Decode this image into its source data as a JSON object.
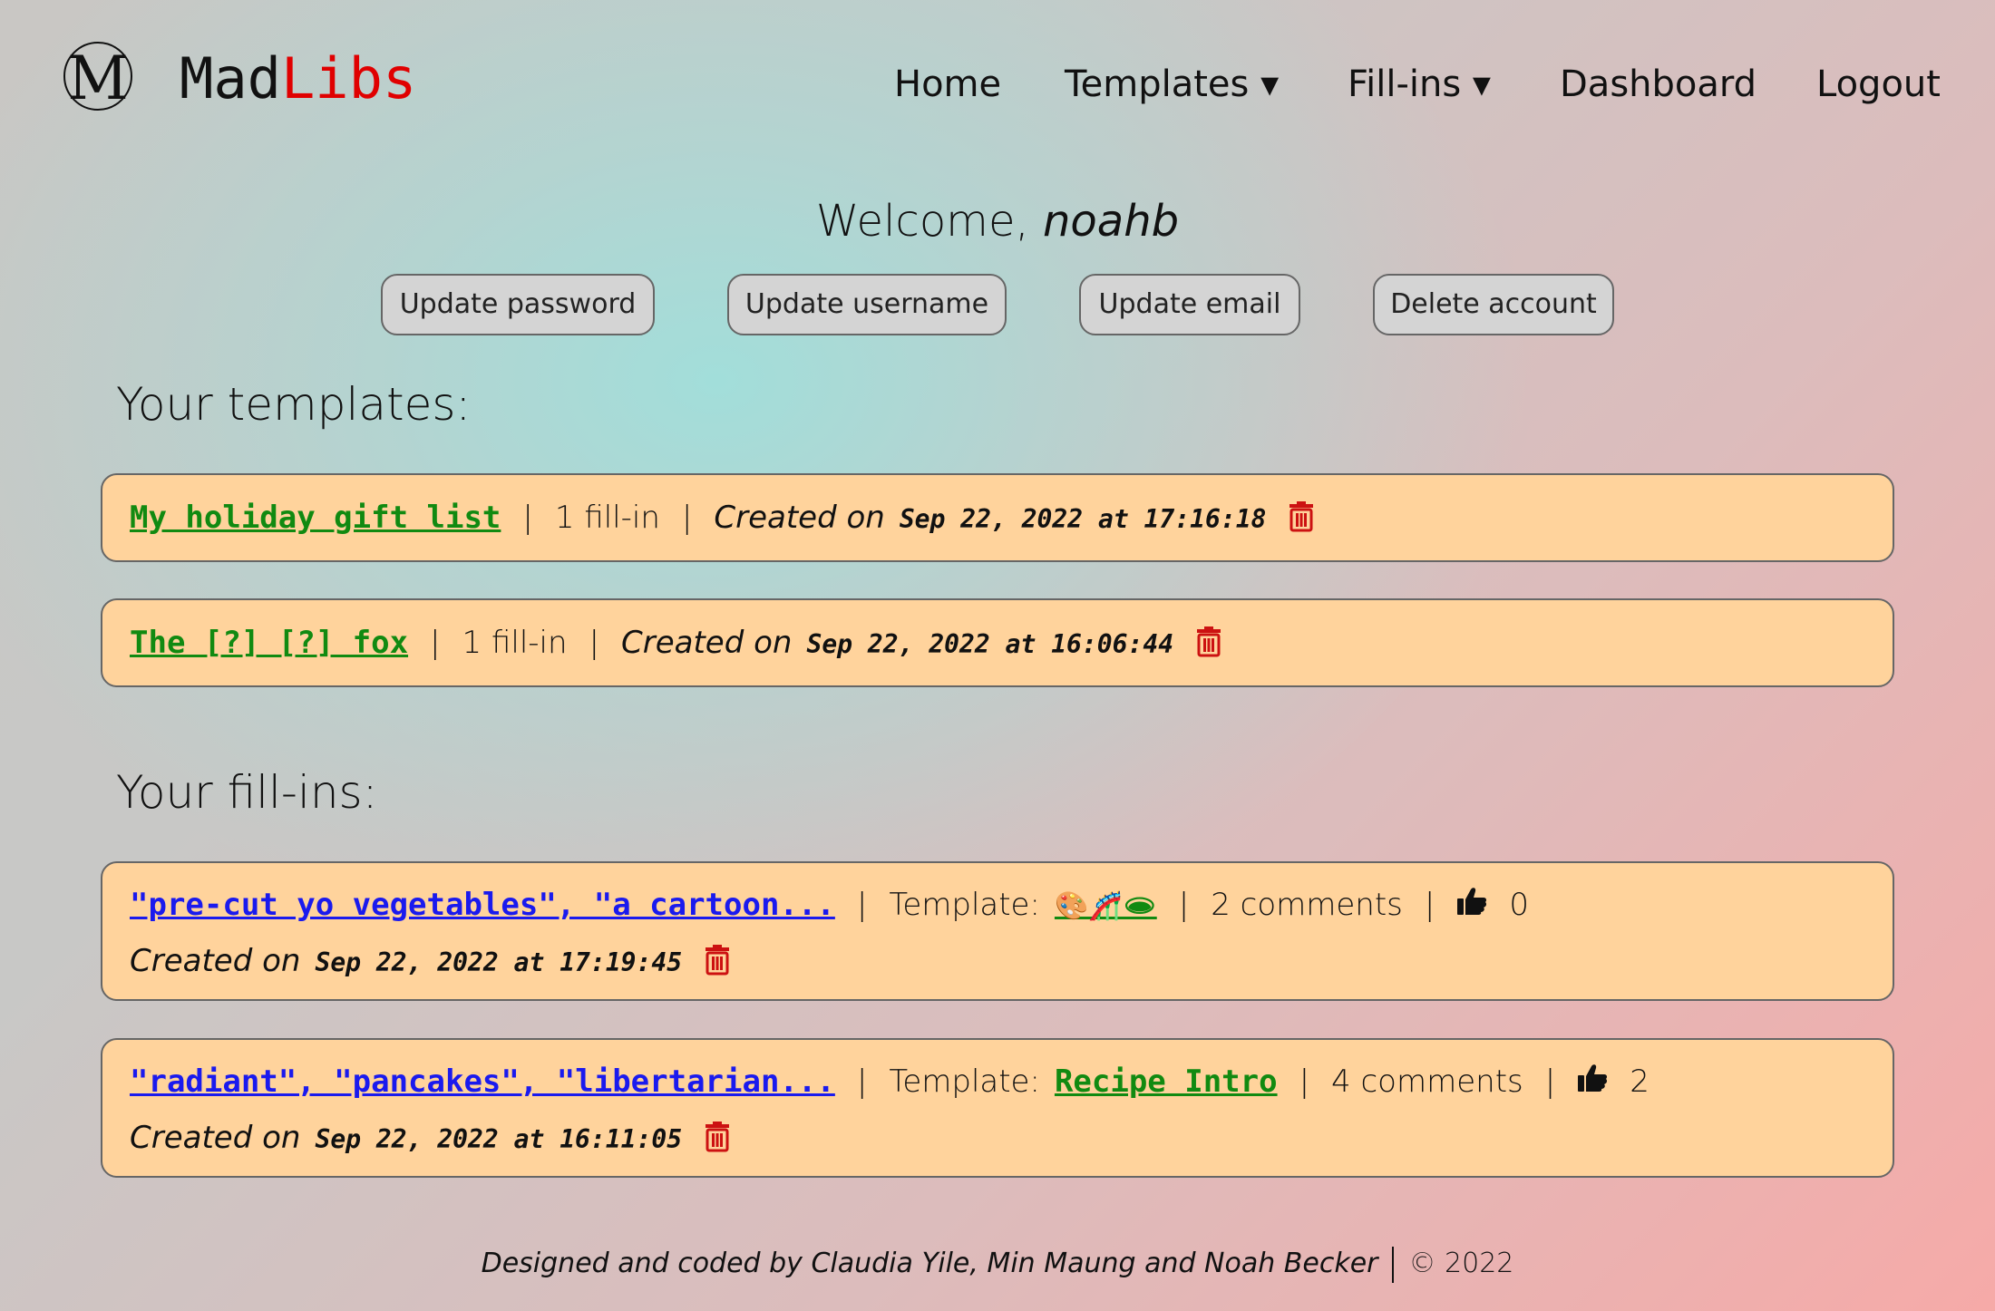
{
  "header": {
    "logo_letter": "M",
    "brand_part1": "Mad",
    "brand_part2": "Libs",
    "nav": {
      "home": "Home",
      "templates": "Templates ▾",
      "fillins": "Fill-ins ▾",
      "dashboard": "Dashboard",
      "logout": "Logout"
    }
  },
  "welcome": {
    "prefix": "Welcome, ",
    "username": "noahb"
  },
  "account_buttons": {
    "update_password": "Update password",
    "update_username": "Update username",
    "update_email": "Update email",
    "delete_account": "Delete account"
  },
  "templates_section": {
    "title": "Your templates:",
    "items": [
      {
        "name": "My holiday gift list",
        "fillins": "1 fill-in",
        "created_label": "Created on",
        "date": "Sep 22, 2022 at 17:16:18"
      },
      {
        "name": "The [?] [?] fox",
        "fillins": "1 fill-in",
        "created_label": "Created on",
        "date": "Sep 22, 2022 at 16:06:44"
      }
    ]
  },
  "fillins_section": {
    "title": "Your fill-ins:",
    "items": [
      {
        "name": "\"pre-cut yo vegetables\", \"a cartoon...",
        "template_label": "Template:",
        "template_name": "🎨🎢🕳",
        "comments": "2 comments",
        "likes": "0",
        "created_label": "Created on",
        "date": "Sep 22, 2022 at 17:19:45"
      },
      {
        "name": "\"radiant\", \"pancakes\", \"libertarian...",
        "template_label": "Template:",
        "template_name": "Recipe Intro",
        "comments": "4 comments",
        "likes": "2",
        "created_label": "Created on",
        "date": "Sep 22, 2022 at 16:11:05"
      }
    ]
  },
  "footer": {
    "credits": "Designed and coded by Claudia Yile, Min Maung and Noah Becker",
    "copyright": "© 2022"
  },
  "colors": {
    "brand_red": "#e00000",
    "card_bg": "#ffd39c",
    "template_link": "#118a11",
    "fillin_link": "#1a1aee",
    "trash": "#cc1111"
  },
  "icons": {
    "trash": "trash-icon",
    "thumbs_up": "thumbs-up-icon"
  }
}
